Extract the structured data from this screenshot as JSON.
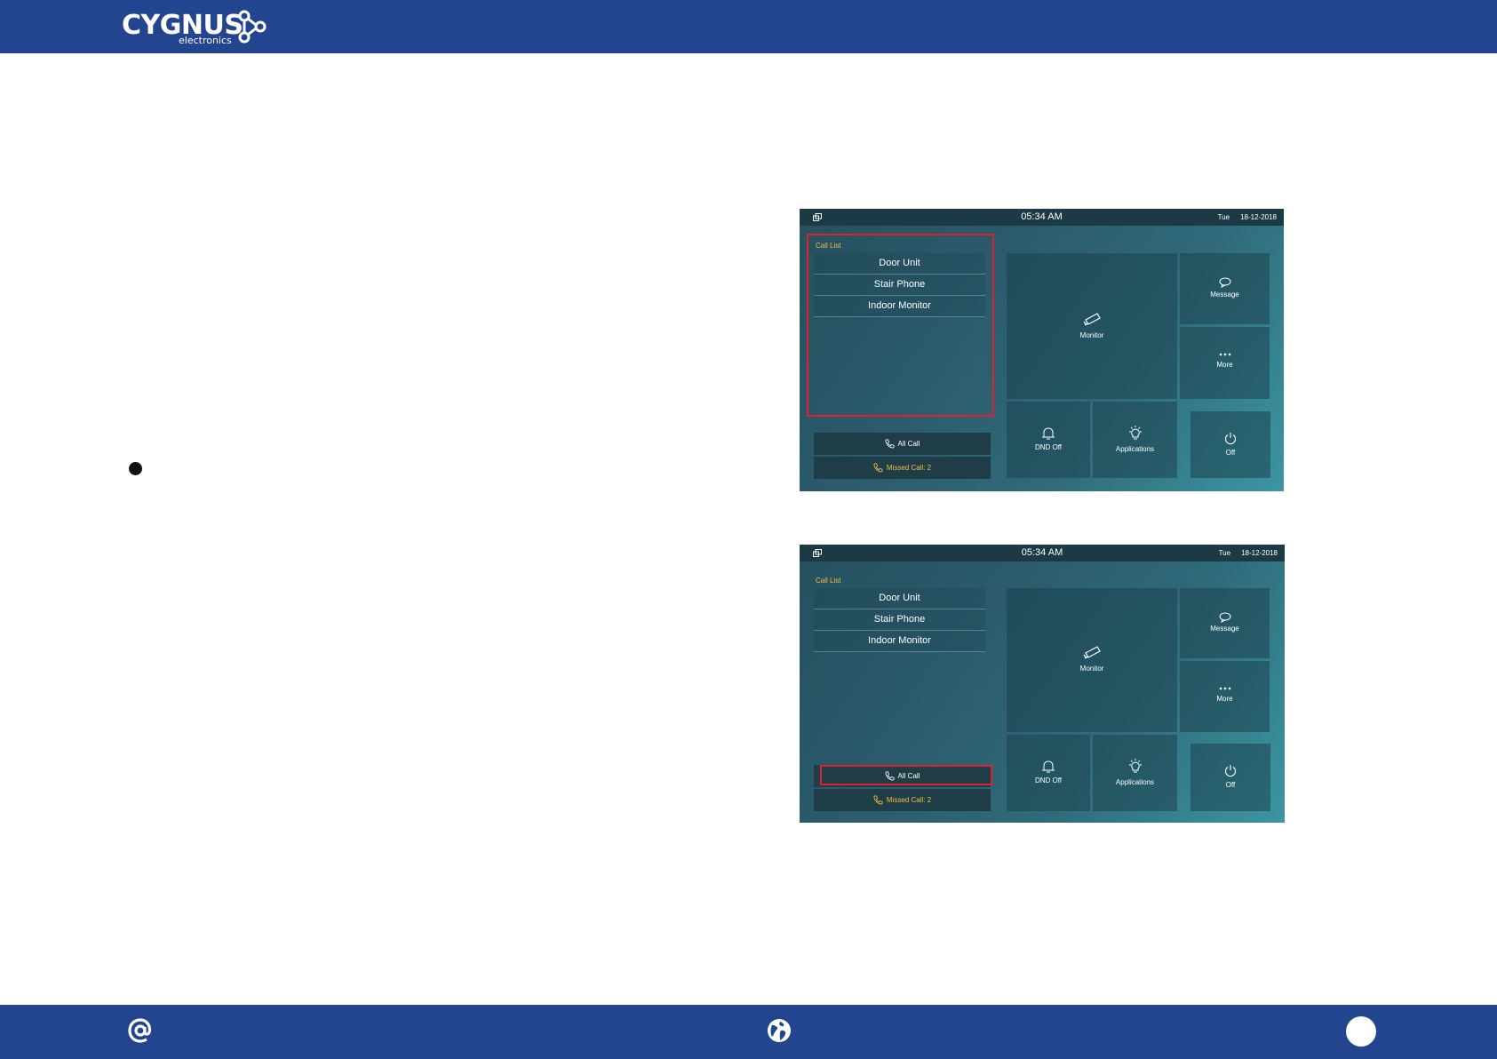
{
  "header": {
    "brand": "CYGNUS",
    "brand_sub": "electronics"
  },
  "screens": [
    {
      "time": "05:34 AM",
      "day": "Tue",
      "date": "18-12-2018",
      "call_list_label": "Call List",
      "call_items": [
        "Door Unit",
        "Stair Phone",
        "Indoor Monitor"
      ],
      "all_call": "All Call",
      "missed_call": "Missed Call: 2",
      "tiles": {
        "monitor": "Monitor",
        "message": "Message",
        "more": "More",
        "dnd": "DND Off",
        "applications": "Applications",
        "off": "Off"
      },
      "highlight": "call-list"
    },
    {
      "time": "05:34 AM",
      "day": "Tue",
      "date": "18-12-2018",
      "call_list_label": "Call List",
      "call_items": [
        "Door Unit",
        "Stair Phone",
        "Indoor Monitor"
      ],
      "all_call": "All Call",
      "missed_call": "Missed Call: 2",
      "tiles": {
        "monitor": "Monitor",
        "message": "Message",
        "more": "More",
        "dnd": "DND Off",
        "applications": "Applications",
        "off": "Off"
      },
      "highlight": "all-call-button"
    }
  ],
  "colors": {
    "brand_blue": "#23458f",
    "highlight_red": "#e02030",
    "accent_yellow": "#f0c040"
  },
  "footer": {
    "icons": [
      "at-icon",
      "globe-icon",
      "circle-icon"
    ]
  }
}
